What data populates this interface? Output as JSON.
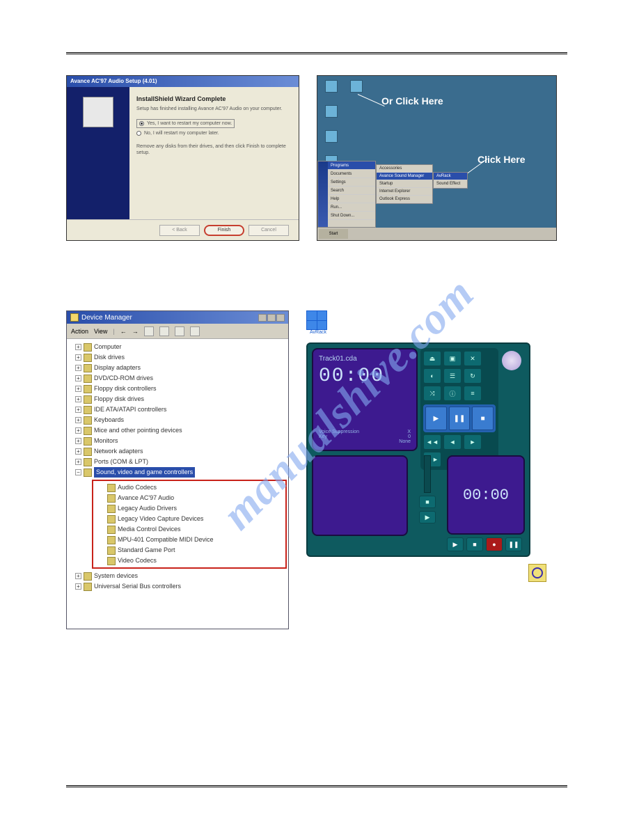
{
  "install": {
    "title": "Avance AC'97 Audio Setup (4.01)",
    "heading": "InstallShield Wizard Complete",
    "text1": "Setup has finished installing Avance AC'97 Audio on your computer.",
    "radio1": "Yes, I want to restart my computer now.",
    "radio2": "No, I will restart my computer later.",
    "text2": "Remove any disks from their drives, and then click Finish to complete setup.",
    "btn_back": "< Back",
    "btn_finish": "Finish",
    "btn_cancel": "Cancel"
  },
  "desktop": {
    "label1": "Or Click Here",
    "label2": "Click Here",
    "start": "Start",
    "menu": [
      "Programs",
      "Documents",
      "Settings",
      "Search",
      "Help",
      "Run...",
      "Shut Down..."
    ],
    "submenu1": [
      "Accessories",
      "Avance Sound Manager",
      "Startup",
      "Internet Explorer",
      "Outlook Express"
    ],
    "submenu2": [
      "AvRack",
      "Sound Effect"
    ],
    "hl1": "Avance Sound Manager",
    "hl2": "AvRack"
  },
  "devmgr": {
    "title": "Device Manager",
    "menu_action": "Action",
    "menu_view": "View",
    "items": [
      "Computer",
      "Disk drives",
      "Display adapters",
      "DVD/CD-ROM drives",
      "Floppy disk controllers",
      "Floppy disk drives",
      "IDE ATA/ATAPI controllers",
      "Keyboards",
      "Mice and other pointing devices",
      "Monitors",
      "Network adapters",
      "Ports (COM & LPT)"
    ],
    "sound": "Sound, video and game controllers",
    "sound_items": [
      "Audio Codecs",
      "Avance AC'97 Audio",
      "Legacy Audio Drivers",
      "Legacy Video Capture Devices",
      "Media Control Devices",
      "MPU-401 Compatible MIDI Device",
      "Standard Game Port",
      "Video Codecs"
    ],
    "after": [
      "System devices",
      "Universal Serial Bus controllers"
    ]
  },
  "avrack": {
    "label": "AvRack"
  },
  "player": {
    "track": "Track01.cda",
    "time1": "00:00",
    "voice": "Voice Suppression",
    "key": "Key",
    "keyval": "0",
    "none": "None",
    "time2": "00:00"
  },
  "watermark": "manualshive.com"
}
